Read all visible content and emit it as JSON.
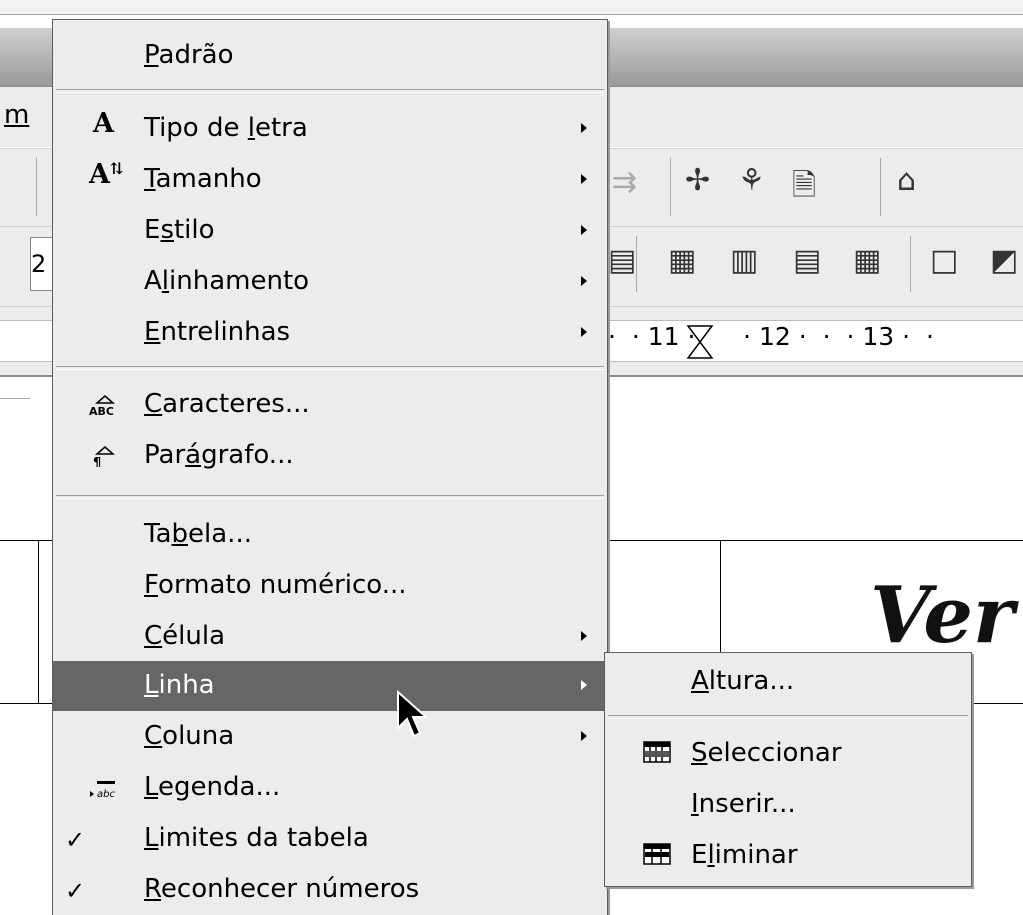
{
  "background": {
    "menubar_fragment": "m",
    "font_size_field": "2",
    "ruler_text": "·  · 11 ·      · 12 ·  ·  · 13 ·  ·",
    "document_text": "Ver"
  },
  "format_menu": {
    "items": [
      {
        "label": "Padrão",
        "mnemonic": "P",
        "submenu": false
      },
      {
        "separator": true
      },
      {
        "label": "Tipo de letra",
        "mnemonic": "l",
        "submenu": true,
        "icon": "font-icon"
      },
      {
        "label": "Tamanho",
        "mnemonic": "T",
        "submenu": true,
        "icon": "font-size-icon"
      },
      {
        "label": "Estilo",
        "mnemonic": "s",
        "submenu": true
      },
      {
        "label": "Alinhamento",
        "mnemonic": "l",
        "submenu": true
      },
      {
        "label": "Entrelinhas",
        "mnemonic": "E",
        "submenu": true
      },
      {
        "separator": true
      },
      {
        "label": "Caracteres...",
        "mnemonic": "C",
        "submenu": false,
        "icon": "characters-icon"
      },
      {
        "label": "Parágrafo...",
        "mnemonic": "á",
        "submenu": false,
        "icon": "paragraph-icon"
      },
      {
        "separator": true
      },
      {
        "label": "Tabela...",
        "mnemonic": "b",
        "submenu": false
      },
      {
        "label": "Formato numérico...",
        "mnemonic": "F",
        "submenu": false
      },
      {
        "label": "Célula",
        "mnemonic": "C",
        "submenu": true
      },
      {
        "label": "Linha",
        "mnemonic": "L",
        "submenu": true,
        "highlighted": true
      },
      {
        "label": "Coluna",
        "mnemonic": "C",
        "submenu": true
      },
      {
        "label": "Legenda...",
        "mnemonic": "L",
        "submenu": false,
        "icon": "caption-icon"
      },
      {
        "label": "Limites da tabela",
        "mnemonic": "L",
        "submenu": false,
        "checked": true
      },
      {
        "label": "Reconhecer números",
        "mnemonic": "R",
        "submenu": false,
        "checked": true
      }
    ]
  },
  "row_submenu": {
    "items": [
      {
        "label": "Altura...",
        "mnemonic": "A"
      },
      {
        "separator": true
      },
      {
        "label": "Seleccionar",
        "mnemonic": "S",
        "icon": "select-row-icon"
      },
      {
        "label": "Inserir...",
        "mnemonic": "I"
      },
      {
        "label": "Eliminar",
        "mnemonic": "l",
        "icon": "delete-row-icon"
      }
    ]
  },
  "colors": {
    "menu_bg": "#ececec",
    "highlight_bg": "#666666",
    "highlight_fg": "#ffffff"
  }
}
